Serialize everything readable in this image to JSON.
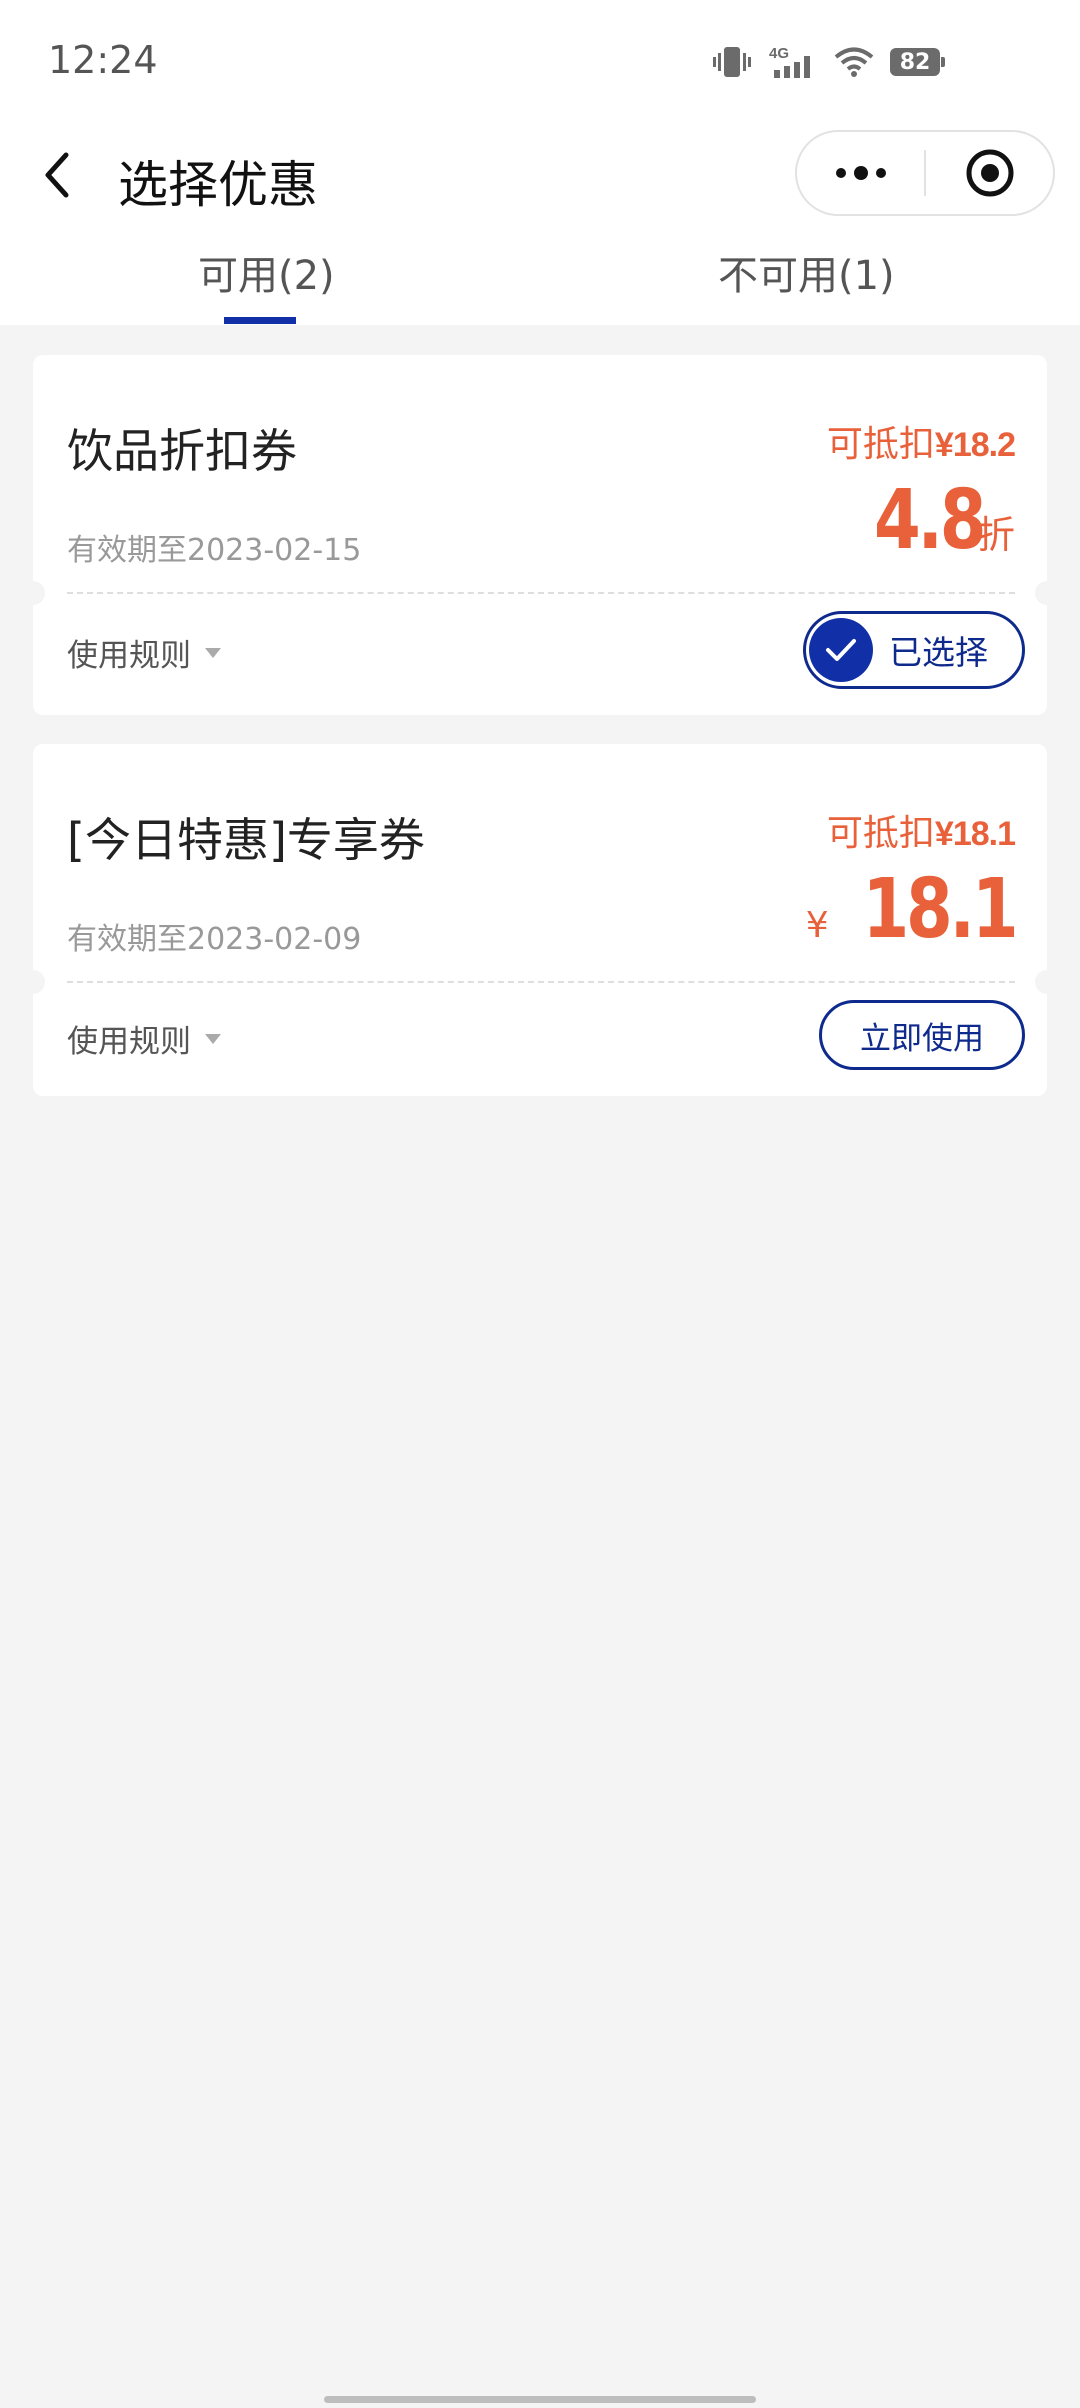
{
  "status_bar": {
    "time": "12:24",
    "network": "4G",
    "battery": "82"
  },
  "header": {
    "title": "选择优惠"
  },
  "tabs": [
    {
      "label": "可用(2)",
      "active": true
    },
    {
      "label": "不可用(1)",
      "active": false
    }
  ],
  "coupons": [
    {
      "title": "饮品折扣券",
      "deduct_label": "可抵扣",
      "deduct_amount": "¥18.2",
      "validity": "有效期至2023-02-15",
      "value": "4.8",
      "value_suffix": "折",
      "rules_label": "使用规则",
      "action_label": "已选择"
    },
    {
      "title": "[今日特惠]专享券",
      "deduct_label": "可抵扣",
      "deduct_amount": "¥18.1",
      "validity": "有效期至2023-02-09",
      "value_prefix": "¥",
      "value": "18.1",
      "rules_label": "使用规则",
      "action_label": "立即使用"
    }
  ],
  "colors": {
    "accent_blue": "#1130a8",
    "accent_orange": "#e8613a",
    "background": "#f4f4f4"
  }
}
